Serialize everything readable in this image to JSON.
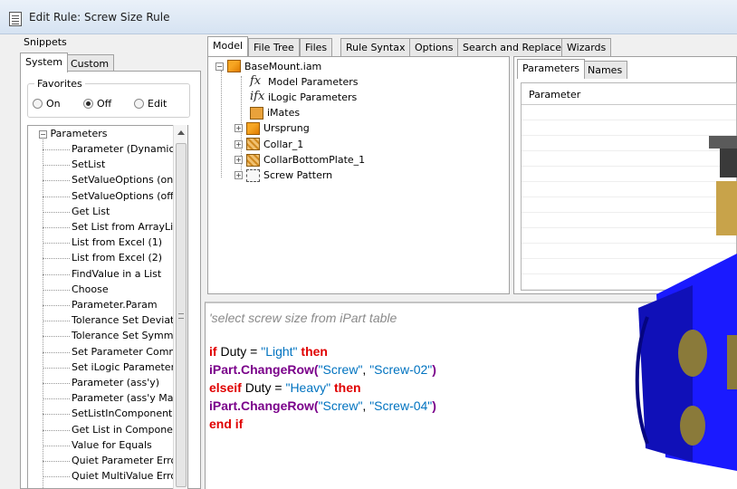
{
  "window": {
    "title": "Edit Rule: Screw Size Rule"
  },
  "snippets": {
    "label": "Snippets",
    "tabs": [
      "System",
      "Custom"
    ],
    "favorites": {
      "label": "Favorites",
      "options": [
        "On",
        "Off",
        "Edit"
      ],
      "selected": "Off"
    },
    "tree": {
      "root": "Parameters",
      "items": [
        "Parameter (Dynamic)",
        "SetList",
        "SetValueOptions (on)",
        "SetValueOptions (off",
        "Get List",
        "Set List from ArrayLis",
        "List from Excel (1)",
        "List from Excel (2)",
        "FindValue in a List",
        "Choose",
        "Parameter.Param",
        "Tolerance Set Deviati",
        "Tolerance Set Symme",
        "Set Parameter Comm",
        "Set iLogic Parameter",
        "Parameter (ass'y)",
        "Parameter (ass'y Mak",
        "SetListInComponent",
        "Get List in Componen",
        "Value for Equals",
        "Quiet Parameter Erro",
        "Quiet MultiValue Erroi"
      ]
    }
  },
  "main_tabs": [
    "Model",
    "File Tree",
    "Files",
    "Rule Syntax",
    "Options",
    "Search and Replace",
    "Wizards"
  ],
  "model_tree": {
    "root": "BaseMount.iam",
    "items": [
      {
        "label": "Model Parameters",
        "icon": "fx-icon",
        "expand": ""
      },
      {
        "label": "iLogic Parameters",
        "icon": "ifx-icon",
        "expand": ""
      },
      {
        "label": "iMates",
        "icon": "imates-icon",
        "expand": ""
      },
      {
        "label": "Ursprung",
        "icon": "folder-assembly-icon",
        "expand": "+"
      },
      {
        "label": "Collar_1",
        "icon": "part-icon",
        "expand": "+"
      },
      {
        "label": "CollarBottomPlate_1",
        "icon": "part-icon",
        "expand": "+"
      },
      {
        "label": "Screw Pattern",
        "icon": "pattern-icon",
        "expand": "+"
      }
    ]
  },
  "params_panel": {
    "tabs": [
      "Parameters",
      "Names"
    ],
    "column_header": "Parameter"
  },
  "code": {
    "comment": "'select screw size from iPart table",
    "line1": {
      "kw_if": "if",
      "var": "Duty",
      "op": "=",
      "str": "\"Light\"",
      "kw_then": "then"
    },
    "line2": {
      "fn": "iPart.ChangeRow(",
      "arg1": "\"Screw\"",
      "comma": ",",
      "arg2": "\"Screw-02\"",
      "close": ")"
    },
    "line3": {
      "kw_elseif": "elseif",
      "var": "Duty",
      "op": "=",
      "str": "\"Heavy\"",
      "kw_then": "then"
    },
    "line4": {
      "fn": "iPart.ChangeRow(",
      "arg1": "\"Screw\"",
      "comma": ",",
      "arg2": "\"Screw-04\"",
      "close": ")"
    },
    "line5": {
      "kw_endif": "end if"
    }
  },
  "colors": {
    "keyword": "#e00000",
    "function": "#7a008a",
    "string": "#0073c0",
    "comment": "#8a8a8a",
    "model_blue": "#1a1aff",
    "model_brass": "#c8a34a"
  }
}
